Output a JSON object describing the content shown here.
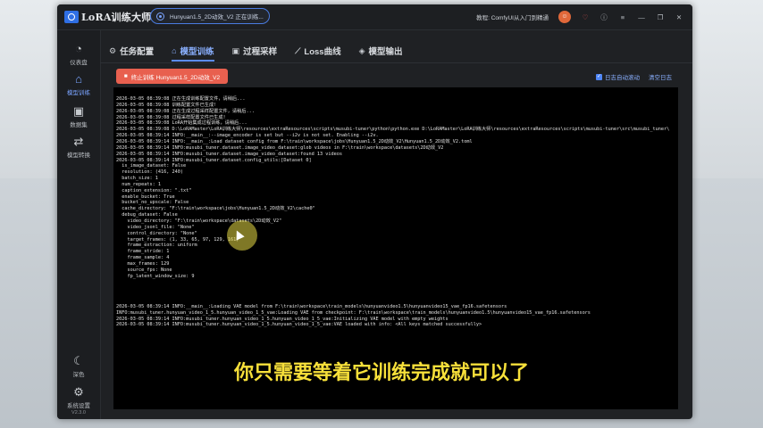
{
  "app": {
    "title": "LoRA训练大师"
  },
  "task_pill": {
    "text": "Hunyuan1.5_2D动效_V2 正在训练..."
  },
  "titlebar": {
    "course": "教程: ComfyUI从入门到精通",
    "icons": [
      "avatar-icon",
      "heart-icon",
      "info-icon",
      "menu-icon",
      "minimize-icon",
      "maximize-icon",
      "close-icon"
    ]
  },
  "sidebar": {
    "items": [
      {
        "label": "仪表盘",
        "icon": "dashboard-icon"
      },
      {
        "label": "模型训练",
        "icon": "training-icon"
      },
      {
        "label": "数据集",
        "icon": "image-icon"
      },
      {
        "label": "模型转换",
        "icon": "convert-icon"
      }
    ],
    "bottom": [
      {
        "label": "深色",
        "icon": "moon-icon"
      },
      {
        "label": "系统设置",
        "icon": "gear-icon"
      }
    ],
    "version": "V2.3.0"
  },
  "tabs": [
    {
      "label": "任务配置",
      "icon": "gear-icon",
      "active": false
    },
    {
      "label": "模型训练",
      "icon": "cube-icon",
      "active": true
    },
    {
      "label": "过程采样",
      "icon": "image-icon",
      "active": false
    },
    {
      "label": "Loss曲线",
      "icon": "chart-icon",
      "active": false
    },
    {
      "label": "模型输出",
      "icon": "box-icon",
      "active": false
    }
  ],
  "actions": {
    "stop_label": "终止训练 Hunyuan1.5_2D动效_V2",
    "auto_scroll": "日志自动滚动",
    "clear_log": "清空日志"
  },
  "log_lines": [
    "2026-03-05 08:39:08 正在生成训练配置文件，请稍后...",
    "2026-03-05 08:39:08 训练配置文件已生成!",
    "2026-03-05 08:39:08 正在生成过程采样配置文件，请稍后...",
    "2026-03-05 08:39:08 过程采样配置文件已生成!",
    "2026-03-05 08:39:08 LoRA开始集成过程训练，请稍后...",
    "2026-03-05 08:39:08 D:\\LoRAMaster\\LoRA训练大师\\resources\\extraResources\\scripts\\musubi-tuner\\python\\python.exe D:\\LoRAMaster\\LoRA训练大师\\resources\\extraResources\\scripts\\musubi-tuner\\src\\musubi_tuner\\",
    "2026-03-05 08:39:14 INFO:__main__:--image_encoder is set but --i2v is not set. Enabling --i2v.",
    "2026-03-05 08:39:14 INFO:__main__:Load dataset config from F:\\train\\workspace\\jobs\\Hunyuan1.5_2D动效_V2\\Hunyuan1.5_2D动效_V2.toml",
    "2026-03-05 08:39:14 INFO:musubi_tuner.dataset.image_video_dataset:glob videos in F:\\train\\workspace\\datasets\\2D动效_V2",
    "2026-03-05 08:39:14 INFO:musubi_tuner.dataset.image_video_dataset:found 13 videos",
    "2026-03-05 08:39:14 INFO:musubi_tuner.dataset.config_utils:[Dataset 0]",
    "  is_image_dataset: False",
    "  resolution: (416, 240)",
    "  batch_size: 1",
    "  num_repeats: 1",
    "  caption_extension: \".txt\"",
    "  enable_bucket: True",
    "  bucket_no_upscale: False",
    "  cache_directory: \"F:\\train\\workspace\\jobs\\Hunyuan1.5_2D动效_V2\\cache0\"",
    "  debug_dataset: False",
    "    video_directory: \"F:\\train\\workspace\\datasets\\2D动效_V2\"",
    "    video_jsonl_file: \"None\"",
    "    control_directory: \"None\"",
    "    target_frames: (1, 33, 65, 97, 129, 161)",
    "    frame_extraction: uniform",
    "    frame_stride: 1",
    "    frame_sample: 4",
    "    max_frames: 129",
    "    source_fps: None",
    "    fp_latent_window_size: 9",
    "",
    "",
    "",
    "",
    "2026-03-05 08:39:14 INFO:__main__:Loading VAE model from F:\\train\\workspace\\train_models\\hunyuanvideo1.5\\hunyuanvideo15_vae_fp16.safetensors",
    "INFO:musubi_tuner.hunyuan_video_1_5.hunyuan_video_1_5_vae:Loading VAE from checkpoint: F:\\train\\workspace\\train_models\\hunyuanvideo1.5\\hunyuanvideo15_vae_fp16.safetensors",
    "2026-03-05 08:39:14 INFO:musubi_tuner.hunyuan_video_1_5.hunyuan_video_1_5_vae:Initializing VAE model with empty weights",
    "2026-03-05 08:39:14 INFO:musubi_tuner.hunyuan_video_1_5.hunyuan_video_1_5_vae:VAE loaded with info: <All keys matched successfully>"
  ],
  "subtitle": "你只需要等着它训练完成就可以了"
}
